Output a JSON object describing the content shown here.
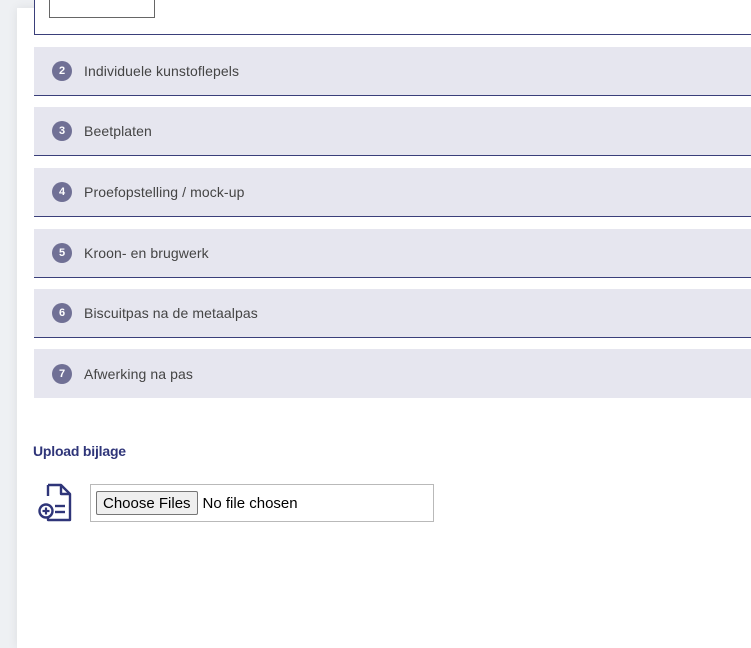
{
  "accordion": {
    "items": [
      {
        "number": "2",
        "label": "Individuele kunstoflepels"
      },
      {
        "number": "3",
        "label": "Beetplaten"
      },
      {
        "number": "4",
        "label": "Proefopstelling / mock-up"
      },
      {
        "number": "5",
        "label": "Kroon- en brugwerk"
      },
      {
        "number": "6",
        "label": "Biscuitpas na de metaalpas"
      },
      {
        "number": "7",
        "label": "Afwerking na pas"
      }
    ]
  },
  "upload": {
    "title": "Upload bijlage",
    "icon": "document-add-icon",
    "button_label": "Choose Files",
    "status": "No file chosen"
  },
  "colors": {
    "accent": "#2f3579",
    "panel": "#e6e6ef",
    "badge": "#707095",
    "divider": "#3a3f7a"
  }
}
